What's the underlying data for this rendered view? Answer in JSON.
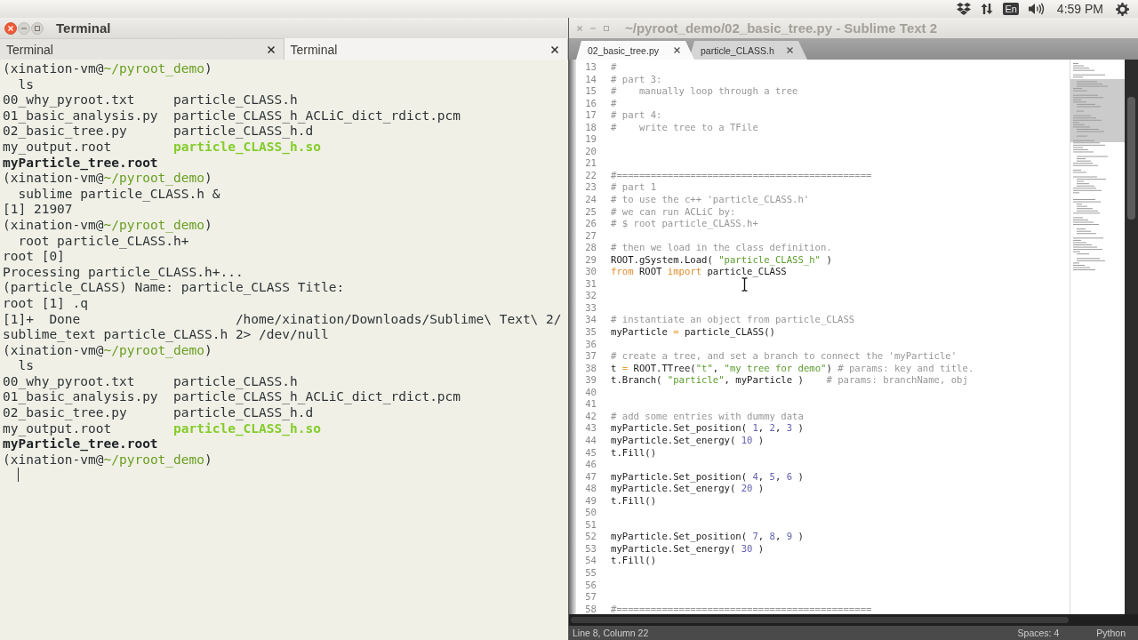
{
  "top_panel": {
    "keyboard_layout": "En",
    "clock": "4:59 PM"
  },
  "terminal": {
    "title": "Terminal",
    "focused": true,
    "tabs": [
      {
        "label": "Terminal",
        "selected": false
      },
      {
        "label": "Terminal",
        "selected": true
      }
    ],
    "lines": [
      {
        "kind": "prompt",
        "segments": [
          {
            "text": "(xination-vm@",
            "kind": "plain"
          },
          {
            "text": "~/pyroot_demo",
            "kind": "path"
          },
          {
            "text": ")",
            "kind": "plain"
          }
        ]
      },
      {
        "kind": "command",
        "text": "ls"
      },
      {
        "kind": "listing",
        "cells": [
          {
            "text": "00_why_pyroot.txt",
            "kind": "file"
          },
          {
            "text": "particle_CLASS.h",
            "kind": "file"
          }
        ]
      },
      {
        "kind": "listing",
        "cells": [
          {
            "text": "01_basic_analysis.py",
            "kind": "file"
          },
          {
            "text": "particle_CLASS_h_ACLiC_dict_rdict.pcm",
            "kind": "file"
          }
        ]
      },
      {
        "kind": "listing",
        "cells": [
          {
            "text": "02_basic_tree.py",
            "kind": "file"
          },
          {
            "text": "particle_CLASS_h.d",
            "kind": "file"
          }
        ]
      },
      {
        "kind": "listing",
        "cells": [
          {
            "text": "my_output.root",
            "kind": "file"
          },
          {
            "text": "particle_CLASS_h.so",
            "kind": "executable"
          }
        ]
      },
      {
        "kind": "listing",
        "cells": [
          {
            "text": "myParticle_tree.root",
            "kind": "bold"
          }
        ]
      },
      {
        "kind": "prompt",
        "segments": [
          {
            "text": "(xination-vm@",
            "kind": "plain"
          },
          {
            "text": "~/pyroot_demo",
            "kind": "path"
          },
          {
            "text": ")",
            "kind": "plain"
          }
        ]
      },
      {
        "kind": "command",
        "text": "sublime particle_CLASS.h &"
      },
      {
        "kind": "output",
        "text": "[1] 21907"
      },
      {
        "kind": "prompt",
        "segments": [
          {
            "text": "(xination-vm@",
            "kind": "plain"
          },
          {
            "text": "~/pyroot_demo",
            "kind": "path"
          },
          {
            "text": ")",
            "kind": "plain"
          }
        ]
      },
      {
        "kind": "command",
        "text": "root particle_CLASS.h+"
      },
      {
        "kind": "output",
        "text": "root [0]"
      },
      {
        "kind": "output",
        "text": "Processing particle_CLASS.h+..."
      },
      {
        "kind": "output",
        "text": "(particle_CLASS) Name: particle_CLASS Title:"
      },
      {
        "kind": "output",
        "text": "root [1] .q"
      },
      {
        "kind": "output",
        "text": "[1]+  Done                    /home/xination/Downloads/Sublime\\ Text\\ 2/"
      },
      {
        "kind": "output",
        "text": "sublime_text particle_CLASS.h 2> /dev/null"
      },
      {
        "kind": "prompt",
        "segments": [
          {
            "text": "(xination-vm@",
            "kind": "plain"
          },
          {
            "text": "~/pyroot_demo",
            "kind": "path"
          },
          {
            "text": ")",
            "kind": "plain"
          }
        ]
      },
      {
        "kind": "command",
        "text": "ls"
      },
      {
        "kind": "listing",
        "cells": [
          {
            "text": "00_why_pyroot.txt",
            "kind": "file"
          },
          {
            "text": "particle_CLASS.h",
            "kind": "file"
          }
        ]
      },
      {
        "kind": "listing",
        "cells": [
          {
            "text": "01_basic_analysis.py",
            "kind": "file"
          },
          {
            "text": "particle_CLASS_h_ACLiC_dict_rdict.pcm",
            "kind": "file"
          }
        ]
      },
      {
        "kind": "listing",
        "cells": [
          {
            "text": "02_basic_tree.py",
            "kind": "file"
          },
          {
            "text": "particle_CLASS_h.d",
            "kind": "file"
          }
        ]
      },
      {
        "kind": "listing",
        "cells": [
          {
            "text": "my_output.root",
            "kind": "file"
          },
          {
            "text": "particle_CLASS_h.so",
            "kind": "executable"
          }
        ]
      },
      {
        "kind": "listing",
        "cells": [
          {
            "text": "myParticle_tree.root",
            "kind": "bold"
          }
        ]
      },
      {
        "kind": "prompt",
        "segments": [
          {
            "text": "(xination-vm@",
            "kind": "plain"
          },
          {
            "text": "~/pyroot_demo",
            "kind": "path"
          },
          {
            "text": ")",
            "kind": "plain"
          }
        ]
      }
    ],
    "cursor_visible": true
  },
  "editor": {
    "title": "~/pyroot_demo/02_basic_tree.py - Sublime Text 2",
    "focused": false,
    "tabs": [
      {
        "label": "02_basic_tree.py",
        "selected": true
      },
      {
        "label": "particle_CLASS.h",
        "selected": false
      }
    ],
    "lines": [
      {
        "number": "13",
        "tokens": [
          {
            "kind": "comment",
            "text": "#"
          }
        ]
      },
      {
        "number": "14",
        "tokens": [
          {
            "kind": "comment",
            "text": "# part 3:"
          }
        ]
      },
      {
        "number": "15",
        "tokens": [
          {
            "kind": "comment",
            "text": "#    manually loop through a tree"
          }
        ]
      },
      {
        "number": "16",
        "tokens": [
          {
            "kind": "comment",
            "text": "#"
          }
        ]
      },
      {
        "number": "17",
        "tokens": [
          {
            "kind": "comment",
            "text": "# part 4:"
          }
        ]
      },
      {
        "number": "18",
        "tokens": [
          {
            "kind": "comment",
            "text": "#    write tree to a TFile"
          }
        ]
      },
      {
        "number": "19"
      },
      {
        "number": "20"
      },
      {
        "number": "21"
      },
      {
        "number": "22",
        "tokens": [
          {
            "kind": "comment",
            "text": "#============================================="
          }
        ]
      },
      {
        "number": "23",
        "tokens": [
          {
            "kind": "comment",
            "text": "# part 1"
          }
        ]
      },
      {
        "number": "24",
        "tokens": [
          {
            "kind": "comment",
            "text": "# to use the c++ 'particle_CLASS.h'"
          }
        ]
      },
      {
        "number": "25",
        "tokens": [
          {
            "kind": "comment",
            "text": "# we can run ACLiC by:"
          }
        ]
      },
      {
        "number": "26",
        "tokens": [
          {
            "kind": "comment",
            "text": "# $ root particle_CLASS.h+"
          }
        ]
      },
      {
        "number": "27"
      },
      {
        "number": "28",
        "tokens": [
          {
            "kind": "comment",
            "text": "# then we load in the class definition."
          }
        ]
      },
      {
        "number": "29",
        "tokens": [
          {
            "kind": "plain",
            "text": "ROOT.gSystem.Load( "
          },
          {
            "kind": "string",
            "text": "\"particle_CLASS_h\""
          },
          {
            "kind": "plain",
            "text": " )"
          }
        ]
      },
      {
        "number": "30",
        "tokens": [
          {
            "kind": "keyword",
            "text": "from"
          },
          {
            "kind": "plain",
            "text": " ROOT "
          },
          {
            "kind": "keyword",
            "text": "import"
          },
          {
            "kind": "plain",
            "text": " particle_CLASS"
          }
        ]
      },
      {
        "number": "31"
      },
      {
        "number": "32"
      },
      {
        "number": "33"
      },
      {
        "number": "34",
        "tokens": [
          {
            "kind": "comment",
            "text": "# instantiate an object from particle_CLASS"
          }
        ]
      },
      {
        "number": "35",
        "tokens": [
          {
            "kind": "plain",
            "text": "myParticle "
          },
          {
            "kind": "operator",
            "text": "="
          },
          {
            "kind": "plain",
            "text": " particle_CLASS()"
          }
        ]
      },
      {
        "number": "36"
      },
      {
        "number": "37",
        "tokens": [
          {
            "kind": "comment",
            "text": "# create a tree, and set a branch to connect the 'myParticle'"
          }
        ]
      },
      {
        "number": "38",
        "tokens": [
          {
            "kind": "plain",
            "text": "t "
          },
          {
            "kind": "operator",
            "text": "="
          },
          {
            "kind": "plain",
            "text": " ROOT.TTree("
          },
          {
            "kind": "string",
            "text": "\"t\""
          },
          {
            "kind": "plain",
            "text": ", "
          },
          {
            "kind": "string",
            "text": "\"my tree for demo\""
          },
          {
            "kind": "plain",
            "text": ") "
          },
          {
            "kind": "comment",
            "text": "# params: key and title."
          }
        ]
      },
      {
        "number": "39",
        "tokens": [
          {
            "kind": "plain",
            "text": "t.Branch( "
          },
          {
            "kind": "string",
            "text": "\"particle\""
          },
          {
            "kind": "plain",
            "text": ", myParticle )    "
          },
          {
            "kind": "comment",
            "text": "# params: branchName, obj"
          }
        ]
      },
      {
        "number": "40"
      },
      {
        "number": "41"
      },
      {
        "number": "42",
        "tokens": [
          {
            "kind": "comment",
            "text": "# add some entries with dummy data"
          }
        ]
      },
      {
        "number": "43",
        "tokens": [
          {
            "kind": "plain",
            "text": "myParticle.Set_position( "
          },
          {
            "kind": "number",
            "text": "1"
          },
          {
            "kind": "plain",
            "text": ", "
          },
          {
            "kind": "number",
            "text": "2"
          },
          {
            "kind": "plain",
            "text": ", "
          },
          {
            "kind": "number",
            "text": "3"
          },
          {
            "kind": "plain",
            "text": " )"
          }
        ]
      },
      {
        "number": "44",
        "tokens": [
          {
            "kind": "plain",
            "text": "myParticle.Set_energy( "
          },
          {
            "kind": "number",
            "text": "10"
          },
          {
            "kind": "plain",
            "text": " )"
          }
        ]
      },
      {
        "number": "45",
        "tokens": [
          {
            "kind": "plain",
            "text": "t.Fill()"
          }
        ]
      },
      {
        "number": "46"
      },
      {
        "number": "47",
        "tokens": [
          {
            "kind": "plain",
            "text": "myParticle.Set_position( "
          },
          {
            "kind": "number",
            "text": "4"
          },
          {
            "kind": "plain",
            "text": ", "
          },
          {
            "kind": "number",
            "text": "5"
          },
          {
            "kind": "plain",
            "text": ", "
          },
          {
            "kind": "number",
            "text": "6"
          },
          {
            "kind": "plain",
            "text": " )"
          }
        ]
      },
      {
        "number": "48",
        "tokens": [
          {
            "kind": "plain",
            "text": "myParticle.Set_energy( "
          },
          {
            "kind": "number",
            "text": "20"
          },
          {
            "kind": "plain",
            "text": " )"
          }
        ]
      },
      {
        "number": "49",
        "tokens": [
          {
            "kind": "plain",
            "text": "t.Fill()"
          }
        ]
      },
      {
        "number": "50"
      },
      {
        "number": "51"
      },
      {
        "number": "52",
        "tokens": [
          {
            "kind": "plain",
            "text": "myParticle.Set_position( "
          },
          {
            "kind": "number",
            "text": "7"
          },
          {
            "kind": "plain",
            "text": ", "
          },
          {
            "kind": "number",
            "text": "8"
          },
          {
            "kind": "plain",
            "text": ", "
          },
          {
            "kind": "number",
            "text": "9"
          },
          {
            "kind": "plain",
            "text": " )"
          }
        ]
      },
      {
        "number": "53",
        "tokens": [
          {
            "kind": "plain",
            "text": "myParticle.Set_energy( "
          },
          {
            "kind": "number",
            "text": "30"
          },
          {
            "kind": "plain",
            "text": " )"
          }
        ]
      },
      {
        "number": "54",
        "tokens": [
          {
            "kind": "plain",
            "text": "t.Fill()"
          }
        ]
      },
      {
        "number": "55"
      },
      {
        "number": "56"
      },
      {
        "number": "57"
      },
      {
        "number": "58",
        "tokens": [
          {
            "kind": "comment",
            "text": "#============================================="
          }
        ]
      }
    ],
    "status_bar": {
      "position": "Line 8, Column 22",
      "indentation": "Spaces: 4",
      "syntax": "Python"
    }
  }
}
